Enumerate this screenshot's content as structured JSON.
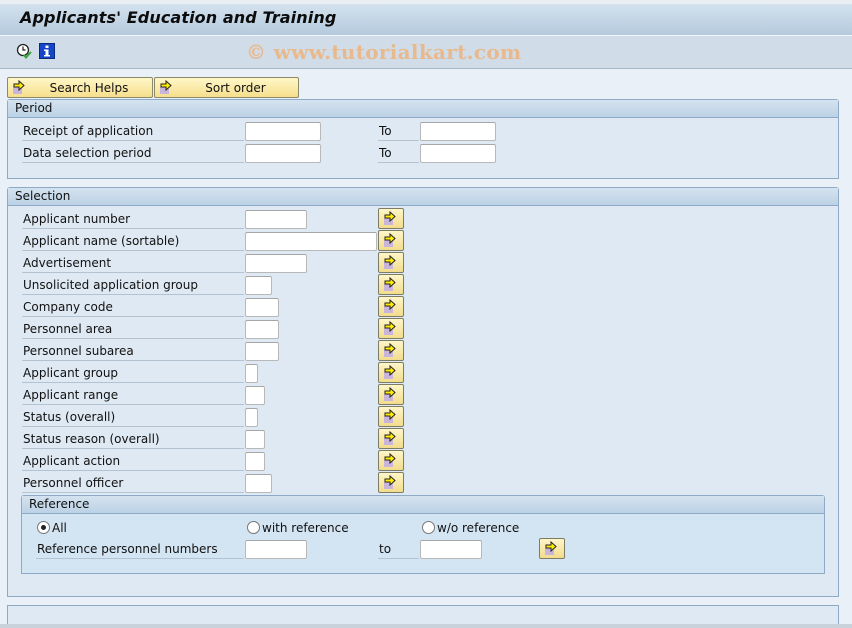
{
  "window": {
    "title": "Applicants' Education and Training",
    "watermark": "© www.tutorialkart.com"
  },
  "toolbar": {
    "icons": [
      {
        "name": "execute-clock-icon"
      },
      {
        "name": "info-icon"
      }
    ],
    "buttons": [
      {
        "label": "Search Helps",
        "icon": "arrow-right-icon"
      },
      {
        "label": "Sort order",
        "icon": "arrow-right-icon"
      }
    ]
  },
  "period": {
    "title": "Period",
    "rows": [
      {
        "label": "Receipt of application",
        "from_value": "",
        "to_label": "To",
        "to_value": ""
      },
      {
        "label": "Data selection period",
        "from_value": "",
        "to_label": "To",
        "to_value": ""
      }
    ]
  },
  "selection": {
    "title": "Selection",
    "rows": [
      {
        "label": "Applicant number",
        "value": ""
      },
      {
        "label": "Applicant name (sortable)",
        "value": ""
      },
      {
        "label": "Advertisement",
        "value": ""
      },
      {
        "label": "Unsolicited application group",
        "value": ""
      },
      {
        "label": "Company code",
        "value": ""
      },
      {
        "label": "Personnel area",
        "value": ""
      },
      {
        "label": "Personnel subarea",
        "value": ""
      },
      {
        "label": "Applicant group",
        "value": ""
      },
      {
        "label": "Applicant range",
        "value": ""
      },
      {
        "label": "Status (overall)",
        "value": ""
      },
      {
        "label": "Status reason (overall)",
        "value": ""
      },
      {
        "label": "Applicant action",
        "value": ""
      },
      {
        "label": "Personnel officer",
        "value": ""
      }
    ],
    "reference": {
      "title": "Reference",
      "options": [
        {
          "label": "All",
          "selected": true
        },
        {
          "label": "with reference",
          "selected": false
        },
        {
          "label": "w/o reference",
          "selected": false
        }
      ],
      "range": {
        "label": "Reference personnel numbers",
        "from_value": "",
        "to_label": "to",
        "to_value": ""
      }
    }
  },
  "colors": {
    "accent_button": "#f6df8c",
    "panel_border": "#8eaac6",
    "watermark": "#e9b98e"
  }
}
